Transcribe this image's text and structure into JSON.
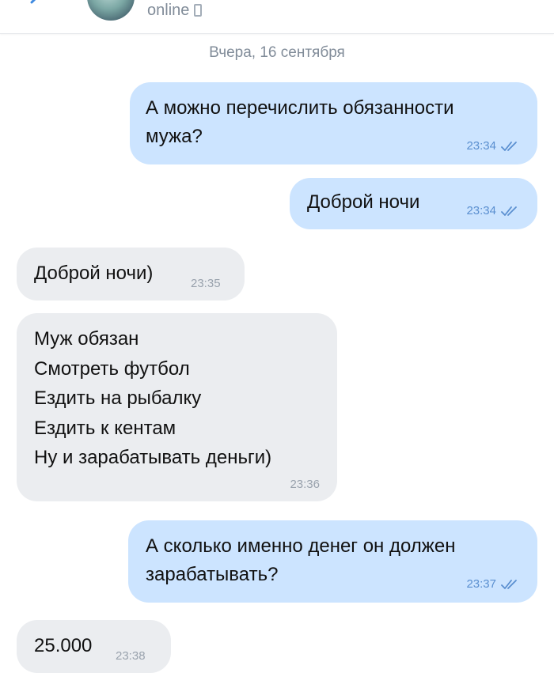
{
  "header": {
    "status": "online",
    "back_icon": "chevron-left-icon",
    "device_icon": "phone-icon"
  },
  "date_separator": "Вчера, 16 сентября",
  "colors": {
    "outgoing_bubble": "#cce4ff",
    "incoming_bubble": "#ebedf0",
    "meta_outgoing": "#5a8fd0",
    "meta_incoming": "#99a2ad"
  },
  "messages": [
    {
      "direction": "out",
      "text": "А можно перечислить обязанности\nмужа?",
      "time": "23:34",
      "read": true
    },
    {
      "direction": "out",
      "text": "Доброй ночи",
      "time": "23:34",
      "read": true
    },
    {
      "direction": "in",
      "text": "Доброй ночи)",
      "time": "23:35"
    },
    {
      "direction": "in",
      "text": "Муж обязан\nСмотреть футбол\nЕздить на рыбалку\nЕздить к кентам\nНу и зарабатывать деньги)",
      "time": "23:36"
    },
    {
      "direction": "out",
      "text": "А сколько именно денег он должен\nзарабатывать?",
      "time": "23:37",
      "read": true
    },
    {
      "direction": "in",
      "text": "25.000",
      "time": "23:38"
    }
  ]
}
